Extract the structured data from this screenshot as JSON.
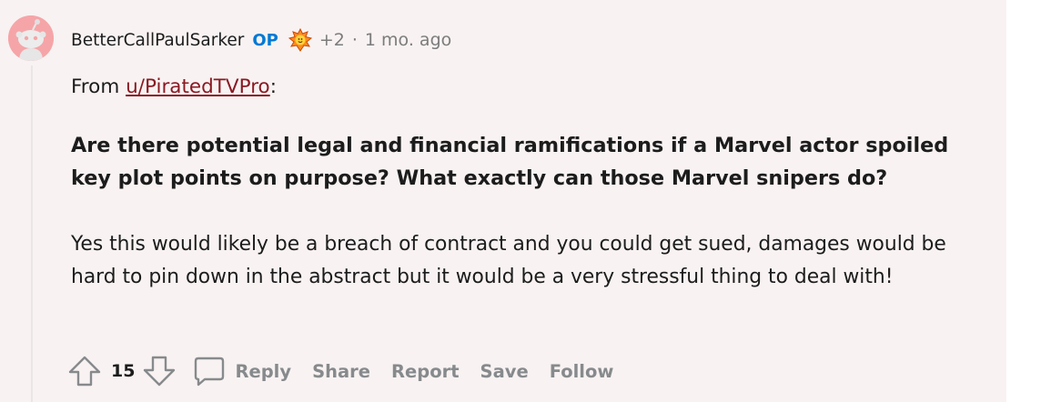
{
  "comment": {
    "username": "BetterCallPaulSarker",
    "op_badge": "OP",
    "award_count": "+2",
    "separator": "·",
    "time": "1 mo. ago",
    "intro_prefix": "From ",
    "intro_link": "u/PiratedTVPro",
    "intro_suffix": ":",
    "question": "Are there potential legal and financial ramifications if a Marvel actor spoiled key plot points on purpose? What exactly can those Marvel snipers do?",
    "answer": "Yes this would likely be a breach of contract and you could get sued, damages would be hard to pin down in the abstract but it would be a very stressful thing to deal with!"
  },
  "actions": {
    "vote_count": "15",
    "reply": "Reply",
    "share": "Share",
    "report": "Report",
    "save": "Save",
    "follow": "Follow"
  },
  "colors": {
    "background": "#f8f2f2",
    "op": "#0079d3",
    "link": "#8a1a23",
    "muted": "#7c7c7c",
    "action": "#878a8c",
    "avatar": "#f5a5a8"
  },
  "icons": [
    "reddit-avatar-icon",
    "award-icon",
    "upvote-icon",
    "downvote-icon",
    "comment-bubble-icon"
  ]
}
